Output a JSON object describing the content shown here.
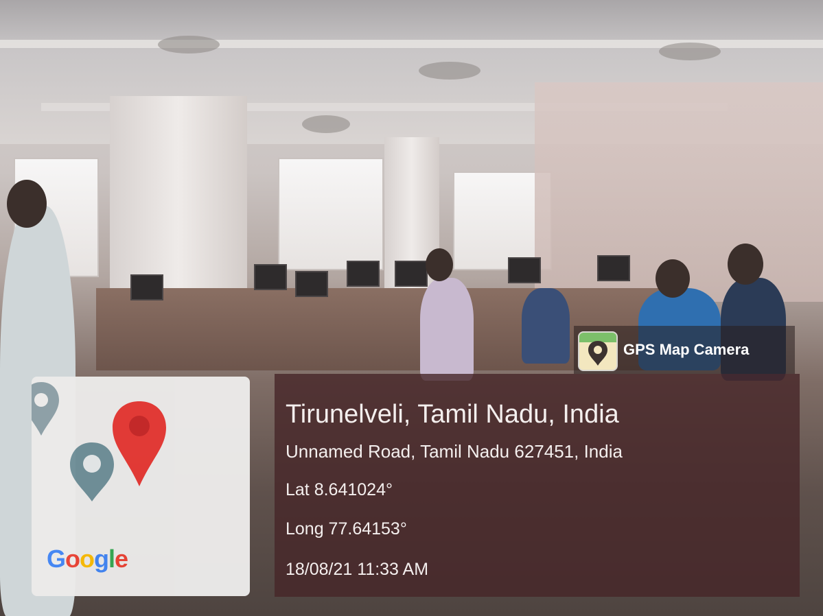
{
  "overlay": {
    "app_badge": {
      "label": "GPS Map Camera",
      "icon": "gps-map-camera-app-icon"
    },
    "map": {
      "logo": "Google",
      "logo_colors": [
        "#4285f4",
        "#ea4335",
        "#fbbc05",
        "#4285f4",
        "#34a853",
        "#ea4335"
      ],
      "pins": [
        {
          "name": "current-location-pin",
          "color": "#e53935"
        },
        {
          "name": "nearby-pin",
          "color": "#5f7f8a"
        },
        {
          "name": "nearby-pin-partial",
          "color": "#5f7f8a"
        }
      ]
    },
    "location": {
      "title": "Tirunelveli, Tamil Nadu, India",
      "address": "Unnamed Road, Tamil Nadu 627451, India",
      "latitude": "Lat 8.641024°",
      "longitude": "Long 77.64153°",
      "datetime": "18/08/21 11:33 AM"
    }
  },
  "colors": {
    "info_panel": "#46262880",
    "text": "#f4efee"
  }
}
